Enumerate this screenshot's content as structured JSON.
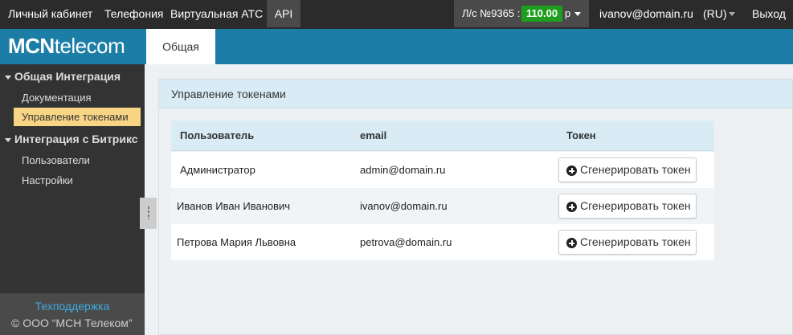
{
  "topbar": {
    "nav": [
      "Личный кабинет",
      "Телефония",
      "Виртуальная АТС",
      "API"
    ],
    "account_label": "Л/с №9365 :",
    "balance": "110.00",
    "currency": "р",
    "user_email": "ivanov@domain.ru",
    "language": "(RU)",
    "logout": "Выход"
  },
  "sidebar": {
    "logo_bold": "MCN",
    "logo_rest": "telecom",
    "groups": [
      {
        "label": "Общая Интеграция",
        "items": [
          "Документация",
          "Управление токенами"
        ]
      },
      {
        "label": "Интеграция с Битрикс",
        "items": [
          "Пользователи",
          "Настройки"
        ]
      }
    ],
    "support": "Техподдержка",
    "copyright": "© ООО “МСН Телеком”"
  },
  "tabs": [
    "Общая"
  ],
  "panel": {
    "title": "Управление токенами",
    "columns": [
      "Пользователь",
      "email",
      "Токен"
    ],
    "rows": [
      {
        "user": "Администратор",
        "email": "admin@domain.ru",
        "action": "Сгенерировать токен"
      },
      {
        "user": "Иванов Иван Иванович",
        "email": "ivanov@domain.ru",
        "action": "Сгенерировать токен"
      },
      {
        "user": "Петрова Мария Львовна",
        "email": "petrova@domain.ru",
        "action": "Сгенерировать токен"
      }
    ]
  },
  "colors": {
    "topbar": "#2b2b2b",
    "brand_blue": "#1c7ea6",
    "balance_green": "#1f9d1f",
    "active_nav_item": "#f8d584",
    "panel_header": "#d9ecf5",
    "support_link": "#3fa9e0"
  },
  "icons": {
    "generate": "plus-circle-icon",
    "dropdown": "caret-down-icon",
    "group_toggle": "triangle-down-icon",
    "resize": "drag-handle-icon"
  }
}
